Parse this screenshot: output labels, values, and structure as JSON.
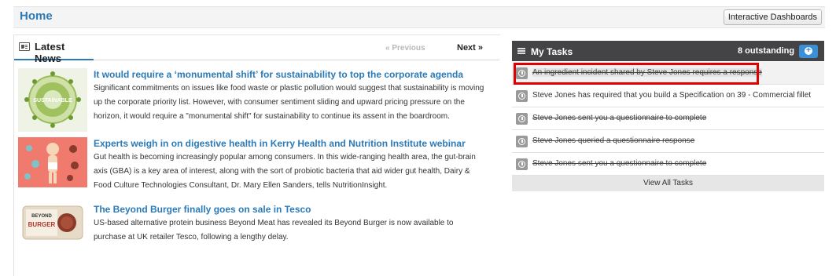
{
  "header": {
    "title": "Home",
    "dashboards_button": "Interactive Dashboards"
  },
  "news": {
    "title": "Latest News",
    "prev_label": "« Previous",
    "next_label": "Next »",
    "articles": [
      {
        "title": "It would require a ‘monumental shift’ for sustainability to top the corporate agenda",
        "body": "Significant commitments on issues like food waste or plastic pollution would suggest that sustainability is moving up the corporate priority list. However, with consumer sentiment sliding and upward pricing pressure on the horizon, it would require a \"monumental shift\" for sustainability to continue its assent in the boardroom.",
        "thumb_label": "SUSTAINABLE"
      },
      {
        "title": "Experts weigh in on digestive health in Kerry Health and Nutrition Institute webinar",
        "body": "Gut health is becoming increasingly popular among consumers. In this wide-ranging health area, the gut-brain axis (GBA) is a key area of interest, along with the sort of probiotic bacteria that aid wider gut health, Dairy & Food Culture Technologies Consultant, Dr. Mary Ellen Sanders, tells NutritionInsight."
      },
      {
        "title": "The Beyond Burger finally goes on sale in Tesco",
        "body": "US-based alternative protein business Beyond Meat has revealed its Beyond Burger is now available to purchase at UK retailer Tesco, following a lengthy delay.",
        "thumb_label_top": "BEYOND",
        "thumb_label_main": "BURGER"
      }
    ]
  },
  "tasks": {
    "title": "My Tasks",
    "count": "8 outstanding",
    "items": [
      {
        "text": "An ingredient incident shared by Steve Jones requires a response",
        "done": true
      },
      {
        "text": "Steve Jones has required that you build a Specification on 39 - Commercial fillet",
        "done": false
      },
      {
        "text": "Steve Jones sent you a questionnaire to complete",
        "done": true
      },
      {
        "text": "Steve Jones queried a questionnaire response",
        "done": true
      },
      {
        "text": "Steve Jones sent you a questionnaire to complete",
        "done": true
      }
    ],
    "view_all": "View All Tasks"
  },
  "colors": {
    "accent": "#2a7ab8",
    "task_header": "#444446",
    "highlight": "#e00000"
  }
}
